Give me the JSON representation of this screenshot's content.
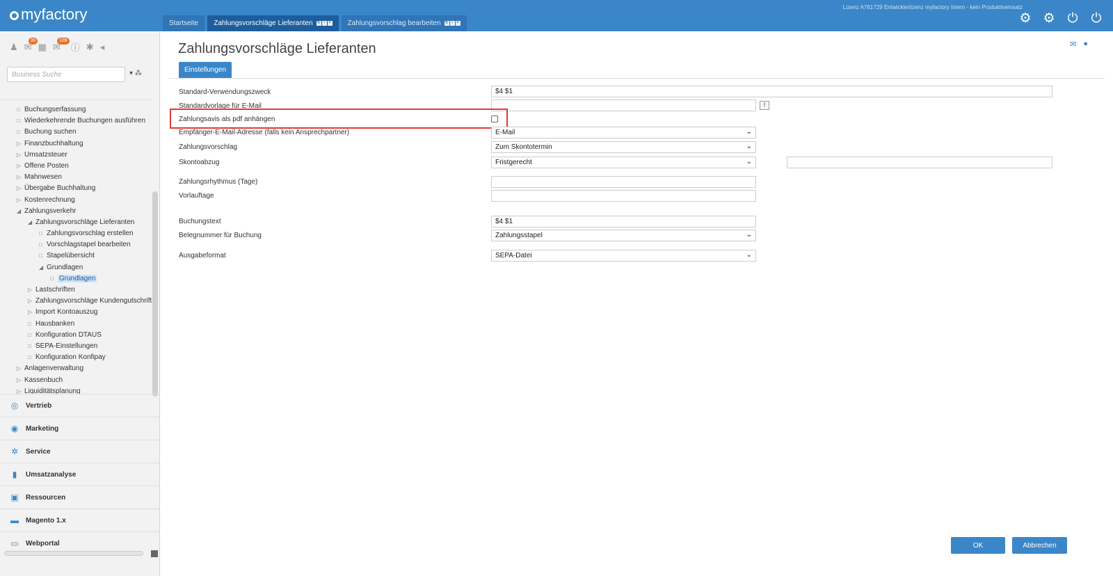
{
  "app": {
    "name": "myfactory",
    "license": "Lizenz A761729 Entwicklerlizenz myfactory Intern - kein Produktiveinsatz"
  },
  "tabs": [
    {
      "label": "Startseite"
    },
    {
      "label": "Zahlungsvorschläge Lieferanten"
    },
    {
      "label": "Zahlungsvorschlag bearbeiten"
    }
  ],
  "sidebar": {
    "badges": {
      "notifications": "30",
      "messages": "108"
    },
    "search_placeholder": "Business Suche",
    "tree": [
      {
        "label": "Buchungserfassung",
        "icon": "□",
        "indent": 24
      },
      {
        "label": "Wiederkehrende Buchungen ausführen",
        "icon": "□",
        "indent": 24
      },
      {
        "label": "Buchung suchen",
        "icon": "□",
        "indent": 24
      },
      {
        "label": "Finanzbuchhaltung",
        "icon": "▷",
        "indent": 24
      },
      {
        "label": "Umsatzsteuer",
        "icon": "▷",
        "indent": 24
      },
      {
        "label": "Offene Posten",
        "icon": "▷",
        "indent": 24
      },
      {
        "label": "Mahnwesen",
        "icon": "▷",
        "indent": 24
      },
      {
        "label": "Übergabe Buchhaltung",
        "icon": "▷",
        "indent": 24
      },
      {
        "label": "Kostenrechnung",
        "icon": "▷",
        "indent": 24
      },
      {
        "label": "Zahlungsverkehr",
        "icon": "◢",
        "indent": 24
      },
      {
        "label": "Zahlungsvorschläge Lieferanten",
        "icon": "◢",
        "indent": 40
      },
      {
        "label": "Zahlungsvorschlag erstellen",
        "icon": "□",
        "indent": 56
      },
      {
        "label": "Vorschlagstapel bearbeiten",
        "icon": "□",
        "indent": 56
      },
      {
        "label": "Stapelübersicht",
        "icon": "□",
        "indent": 56
      },
      {
        "label": "Grundlagen",
        "icon": "◢",
        "indent": 56
      },
      {
        "label": "Grundlagen",
        "icon": "□",
        "indent": 72,
        "selected": true
      },
      {
        "label": "Lastschriften",
        "icon": "▷",
        "indent": 40
      },
      {
        "label": "Zahlungsvorschläge Kundengutschrift",
        "icon": "▷",
        "indent": 40
      },
      {
        "label": "Import Kontoauszug",
        "icon": "▷",
        "indent": 40
      },
      {
        "label": "Hausbanken",
        "icon": "□",
        "indent": 40
      },
      {
        "label": "Konfiguration DTAUS",
        "icon": "□",
        "indent": 40
      },
      {
        "label": "SEPA-Einstellungen",
        "icon": "□",
        "indent": 40
      },
      {
        "label": "Konfiguration Konfipay",
        "icon": "□",
        "indent": 40
      },
      {
        "label": "Anlagenverwaltung",
        "icon": "▷",
        "indent": 24
      },
      {
        "label": "Kassenbuch",
        "icon": "▷",
        "indent": 24
      },
      {
        "label": "Liquiditätsplanung",
        "icon": "▷",
        "indent": 24
      }
    ],
    "modules": [
      {
        "label": "Vertrieb",
        "icon": "◎"
      },
      {
        "label": "Marketing",
        "icon": "◉"
      },
      {
        "label": "Service",
        "icon": "✲"
      },
      {
        "label": "Umsatzanalyse",
        "icon": "▮"
      },
      {
        "label": "Ressourcen",
        "icon": "▣"
      },
      {
        "label": "Magento 1.x",
        "icon": "▬"
      },
      {
        "label": "Webportal",
        "icon": "▭"
      }
    ]
  },
  "main": {
    "title": "Zahlungsvorschläge Lieferanten",
    "settings_tab": "Einstellungen",
    "labels": {
      "verwendungszweck": "Standard-Verwendungszweck",
      "vorlage_email": "Standardvorlage für E-Mail",
      "avis_pdf": "Zahlungsavis als pdf anhängen",
      "empfaenger": "Empfänger-E-Mail-Adresse (falls kein Ansprechpartner)",
      "zahlungsvorschlag": "Zahlungsvorschlag",
      "skontoabzug": "Skontoabzug",
      "rhythmus": "Zahlungsrhythmus (Tage)",
      "vorlauftage": "Vorlauftage",
      "buchungstext": "Buchungstext",
      "belegnummer": "Belegnummer für Buchung",
      "ausgabeformat": "Ausgabeformat"
    },
    "values": {
      "verwendungszweck": "$4 $1",
      "vorlage_email": "",
      "avis_pdf_checked": false,
      "empfaenger": "E-Mail",
      "zahlungsvorschlag": "Zum Skontotermin",
      "skontoabzug": "Fristgerecht",
      "skonto_extra": "",
      "rhythmus": "",
      "vorlauftage": "",
      "buchungstext": "$4 $1",
      "belegnummer": "Zahlungsstapel",
      "ausgabeformat": "SEPA-Datei"
    },
    "buttons": {
      "ok": "OK",
      "cancel": "Abbrechen"
    }
  }
}
